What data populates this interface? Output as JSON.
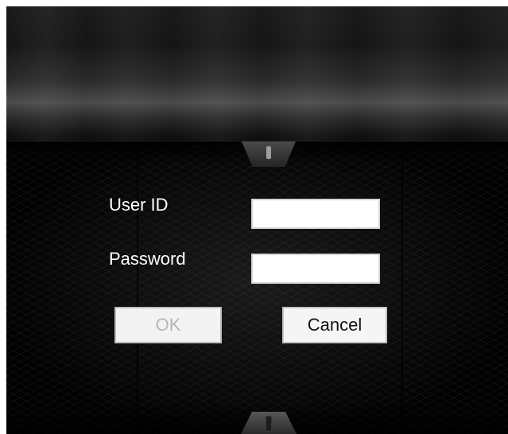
{
  "login_form": {
    "user_id_label": "User ID",
    "user_id_value": "",
    "password_label": "Password",
    "password_value": "",
    "ok_button_label": "OK",
    "cancel_button_label": "Cancel"
  }
}
